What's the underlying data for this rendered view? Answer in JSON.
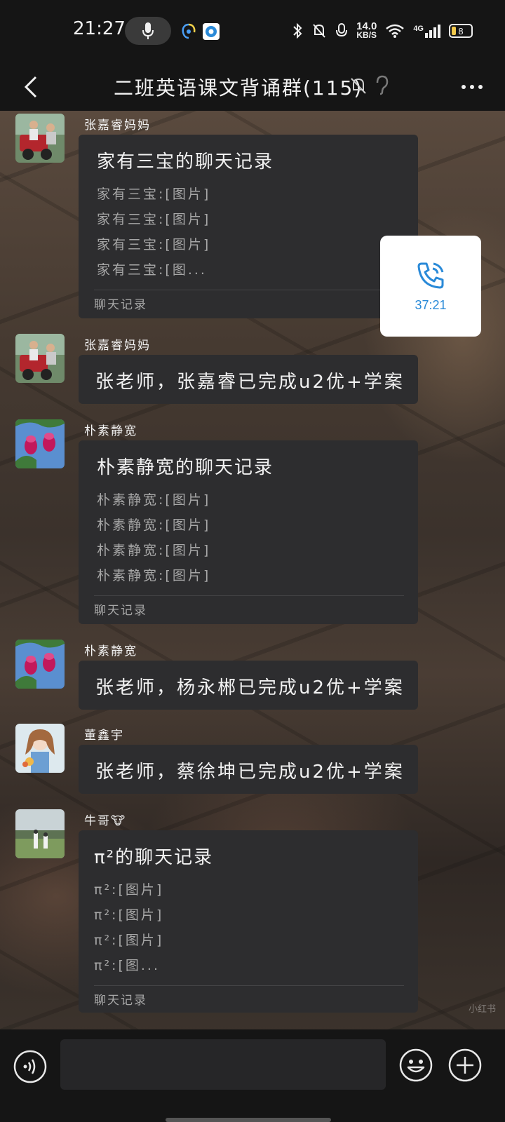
{
  "status_bar": {
    "time": "21:27",
    "net_speed_value": "14.0",
    "net_speed_unit": "KB/S",
    "signal_label": "4G",
    "battery_level": "8"
  },
  "header": {
    "title": "二班英语课文背诵群(115)"
  },
  "call_widget": {
    "duration": "37:21",
    "accent_color": "#2a8ad8"
  },
  "messages": [
    {
      "sender": "张嘉睿妈妈",
      "type": "record",
      "title": "家有三宝的聊天记录",
      "lines": [
        "家有三宝:[图片]",
        "家有三宝:[图片]",
        "家有三宝:[图片]",
        "家有三宝:[图..."
      ],
      "footer": "聊天记录"
    },
    {
      "sender": "张嘉睿妈妈",
      "type": "text",
      "text": "张老师，张嘉睿已完成u2优+学案"
    },
    {
      "sender": "朴素静宽",
      "type": "record",
      "title": "朴素静宽的聊天记录",
      "lines": [
        "朴素静宽:[图片]",
        "朴素静宽:[图片]",
        "朴素静宽:[图片]",
        "朴素静宽:[图片]"
      ],
      "footer": "聊天记录"
    },
    {
      "sender": "朴素静宽",
      "type": "text",
      "text": "张老师，杨永郴已完成u2优+学案"
    },
    {
      "sender": "董鑫宇",
      "type": "text",
      "text": "张老师，蔡徐坤已完成u2优+学案"
    },
    {
      "sender": "牛哥🐮",
      "type": "record",
      "title": "π²的聊天记录",
      "lines": [
        "π²:[图片]",
        "π²:[图片]",
        "π²:[图片]",
        "π²:[图..."
      ],
      "footer": "聊天记录"
    }
  ],
  "watermark": "小红书",
  "icons": {
    "back": "back-arrow-icon",
    "mute": "bell-mute-icon",
    "ear": "ear-icon",
    "more": "more-dots-icon",
    "phone": "phone-call-icon",
    "voice": "voice-input-icon",
    "emoji": "emoji-icon",
    "plus": "plus-icon"
  }
}
